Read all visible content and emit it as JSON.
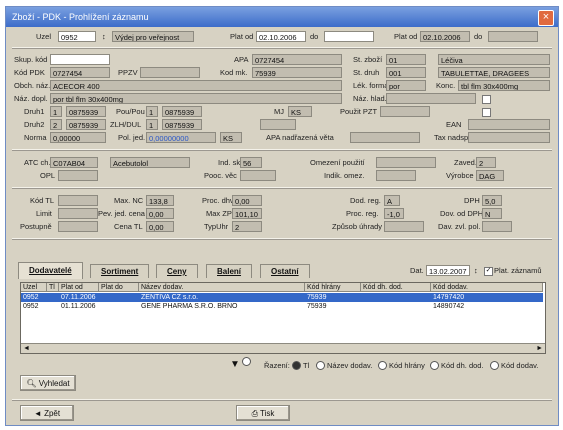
{
  "window": {
    "title": "Zboží - PDK - Prohlížení záznamu",
    "close_label": "×"
  },
  "fields": {
    "uzel_label": "Uzel",
    "uzel_value": "0952",
    "uzel_desc": "Výdej pro veřejnost",
    "plat_od_label": "Plat od",
    "plat_od_value": "02.10.2006",
    "do_label": "do",
    "plat_od2_label": "Plat od",
    "plat_od2_value": "02.10.2006",
    "do2_label": "do",
    "skup_kod_label": "Skup. kód",
    "apa_label": "APA",
    "apa_value": "0727454",
    "st_zbozi_label": "St. zboží",
    "st_zbozi_value": "01",
    "st_zbozi_desc": "Léčiva",
    "kod_pdk_label": "Kód PDK",
    "kod_pdk_value": "0727454",
    "ppzv_label": "PPZV",
    "kod_mk_label": "Kod mk.",
    "kod_mk_value": "75939",
    "st_druh_label": "St. druh",
    "st_druh_value": "001",
    "st_druh_desc": "TABULETTAE, DRAGEES",
    "obch_naz_label": "Obch. náz.",
    "obch_naz_value": "ACECOR 400",
    "lek_forma_label": "Lék. forma",
    "lek_forma_value": "por",
    "konc_label": "Konc.",
    "konc_value": "tbl flm 30x400mg",
    "naz_dopl_label": "Náz. dopl.",
    "naz_dopl_value": "por tbl flm 30x400mg",
    "naz_hlad_label": "Náz. hlad.",
    "druh1_label": "Druh1",
    "druh1_a": "1",
    "druh1_b": "0875939",
    "pou_pou_label": "Pou/Pou",
    "pou_pou_a": "1",
    "pou_pou_b": "0875939",
    "mj_label": "MJ",
    "mj_value": "KS",
    "pouzit_pzt_label": "Použit PZT",
    "druh2_label": "Druh2",
    "druh2_a": "2",
    "druh2_b": "0875939",
    "zlh_label": "ZLH/DUL",
    "zlh_a": "1",
    "zlh_b": "0875939",
    "ean_label": "EAN",
    "norma_label": "Norma",
    "norma_value": "0,00000",
    "pol_jed_label": "Pol. jed.",
    "pol_jed_value": "0,00000000",
    "pol_jed_unit": "KS",
    "apa_nadr_label": "APA nadřazená věta",
    "tax_nadsp_label": "Tax nadsp",
    "atc_label": "ATC ch.",
    "atc_value": "C07AB04",
    "atc_desc": "Acebutolol",
    "ind_sk_label": "Ind. sk.",
    "ind_sk_value": "56",
    "omezeni_label": "Omezení použití",
    "zaved_label": "Zaved.",
    "zaved_value": "2",
    "opl_label": "OPL",
    "pooc_vec_label": "Pooc. věc",
    "indik_omez_label": "Indik. omez.",
    "vyrobce_label": "Výrobce",
    "vyrobce_value": "DAG",
    "kod_tl_label": "Kód TL",
    "max_nc_label": "Max. NC",
    "max_nc_value": "133,8",
    "proc_dhv_label": "Proc. dhv",
    "proc_dhv_value": "0,00",
    "dod_reg_label": "Dod. reg.",
    "dod_reg_value": "A",
    "dph_label": "DPH",
    "dph_value": "5,0",
    "limit_label": "Limit",
    "pev_jed_label": "Pev. jed. cena",
    "pev_jed_value": "0,00",
    "max_zp_label": "Max ZP",
    "max_zp_value": "101,10",
    "proc_reg_label": "Proc. reg.",
    "proc_reg_value": "-1,0",
    "dov_label": "Dov. od DPH",
    "dov_value": "N",
    "postupne_label": "Postupně",
    "cena_tl_label": "Cena TL",
    "cena_tl_value": "0,00",
    "typ_uhr_label": "TypUhr",
    "typ_uhr_value": "2",
    "zpusob_label": "Způsob úhrady",
    "dav_label": "Dav. zvl. pol."
  },
  "tabs": [
    "Dodavatelé",
    "Sortiment",
    "Ceny",
    "Balení",
    "Ostatní"
  ],
  "filter": {
    "dat_label": "Dat.",
    "dat_value": "13.02.2007",
    "plat_label": "Plat. záznamů"
  },
  "grid": {
    "headers": [
      "Uzel",
      "Tl",
      "Plat od",
      "Plat do",
      "Název dodav.",
      "Kód hlrány",
      "Kód dh. dod.",
      "Kód dodav."
    ],
    "rows": [
      [
        "0952",
        "",
        "07.11.2006",
        "",
        "ZENTIVA CZ s.r.o.",
        "75939",
        "",
        "14797420"
      ],
      [
        "0952",
        "",
        "01.11.2006",
        "",
        "GENE PHARMA S.R.O. BRNO",
        "75939",
        "",
        "14890742"
      ]
    ]
  },
  "sort": {
    "label": "Řazení:",
    "options": [
      "Tl",
      "Název dodav.",
      "Kód hlrány",
      "Kód dh. dod.",
      "Kód dodav."
    ]
  },
  "buttons": {
    "search": "Vyhledat",
    "back": "Zpět",
    "print": "Tisk"
  }
}
